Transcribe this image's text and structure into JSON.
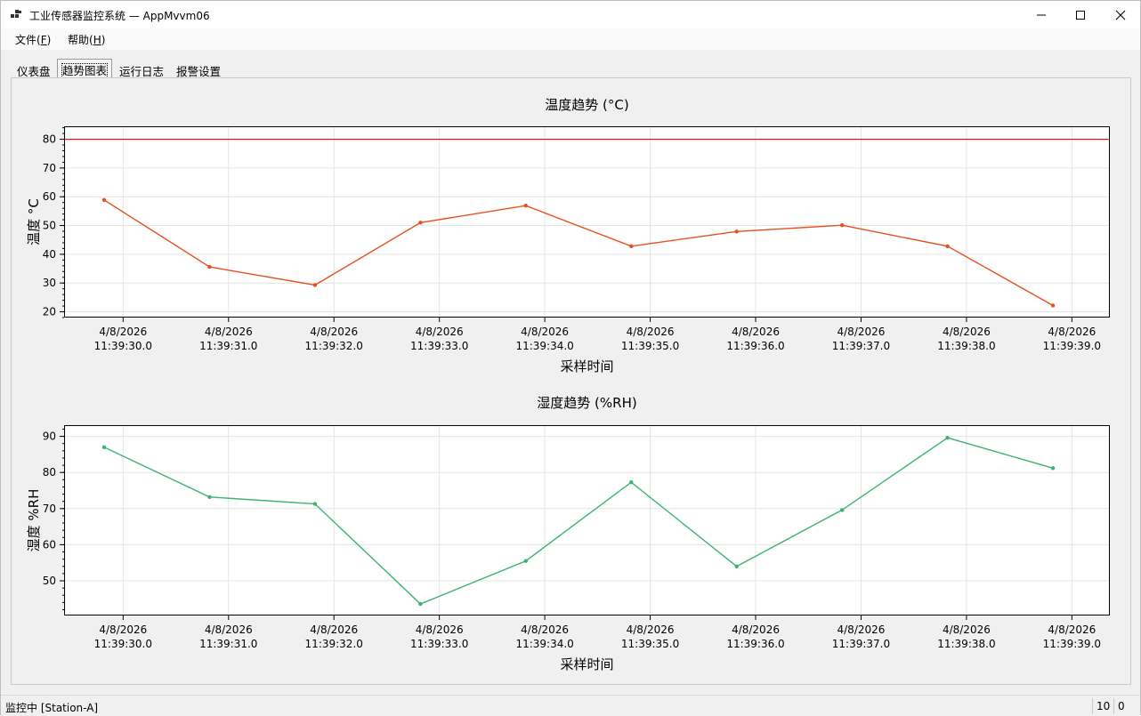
{
  "window": {
    "title": "工业传感器监控系统 — AppMvvm06"
  },
  "menu": {
    "file": "文件",
    "file_key": "F",
    "help": "帮助",
    "help_key": "H"
  },
  "tabs": [
    {
      "label": "仪表盘",
      "active": false
    },
    {
      "label": "趋势图表",
      "active": true
    },
    {
      "label": "运行日志",
      "active": false
    },
    {
      "label": "报警设置",
      "active": false
    }
  ],
  "status": {
    "text": "监控中 [Station-A]",
    "count": "10",
    "alarms": "0"
  },
  "chart_data": [
    {
      "type": "line",
      "title": "温度趋势 (°C)",
      "xlabel": "采样时间",
      "ylabel": "温度 °C",
      "x": [
        "4/8/2026 11:39:30.0",
        "4/8/2026 11:39:31.0",
        "4/8/2026 11:39:32.0",
        "4/8/2026 11:39:33.0",
        "4/8/2026 11:39:34.0",
        "4/8/2026 11:39:35.0",
        "4/8/2026 11:39:36.0",
        "4/8/2026 11:39:37.0",
        "4/8/2026 11:39:38.0",
        "4/8/2026 11:39:39.0"
      ],
      "tick_dates": [
        "4/8/2026",
        "4/8/2026",
        "4/8/2026",
        "4/8/2026",
        "4/8/2026",
        "4/8/2026",
        "4/8/2026",
        "4/8/2026",
        "4/8/2026",
        "4/8/2026"
      ],
      "tick_times": [
        "11:39:30.0",
        "11:39:31.0",
        "11:39:32.0",
        "11:39:33.0",
        "11:39:34.0",
        "11:39:35.0",
        "11:39:36.0",
        "11:39:37.0",
        "11:39:38.0",
        "11:39:39.0"
      ],
      "point_x_seconds": [
        29.82,
        30.82,
        31.82,
        32.82,
        33.82,
        34.82,
        35.82,
        36.82,
        37.82,
        38.82
      ],
      "series": [
        {
          "values": [
            58.9,
            35.6,
            29.3,
            51.0,
            56.9,
            42.8,
            47.9,
            50.1,
            42.8,
            22.2
          ],
          "color": "#e8501e"
        }
      ],
      "yticks": [
        20,
        30,
        40,
        50,
        60,
        70,
        80
      ],
      "ylim": [
        18,
        84.5
      ],
      "xlim": [
        29.44,
        39.36
      ],
      "threshold": {
        "value": 80,
        "color": "#ff0000"
      },
      "grid": true
    },
    {
      "type": "line",
      "title": "湿度趋势 (%RH)",
      "xlabel": "采样时间",
      "ylabel": "湿度 %RH",
      "x": [
        "4/8/2026 11:39:30.0",
        "4/8/2026 11:39:31.0",
        "4/8/2026 11:39:32.0",
        "4/8/2026 11:39:33.0",
        "4/8/2026 11:39:34.0",
        "4/8/2026 11:39:35.0",
        "4/8/2026 11:39:36.0",
        "4/8/2026 11:39:37.0",
        "4/8/2026 11:39:38.0",
        "4/8/2026 11:39:39.0"
      ],
      "tick_dates": [
        "4/8/2026",
        "4/8/2026",
        "4/8/2026",
        "4/8/2026",
        "4/8/2026",
        "4/8/2026",
        "4/8/2026",
        "4/8/2026",
        "4/8/2026",
        "4/8/2026"
      ],
      "tick_times": [
        "11:39:30.0",
        "11:39:31.0",
        "11:39:32.0",
        "11:39:33.0",
        "11:39:34.0",
        "11:39:35.0",
        "11:39:36.0",
        "11:39:37.0",
        "11:39:38.0",
        "11:39:39.0"
      ],
      "point_x_seconds": [
        29.82,
        30.82,
        31.82,
        32.82,
        33.82,
        34.82,
        35.82,
        36.82,
        37.82,
        38.82
      ],
      "series": [
        {
          "values": [
            87.0,
            73.2,
            71.3,
            43.6,
            55.5,
            77.3,
            54.0,
            69.6,
            89.6,
            81.2
          ],
          "color": "#3cb371"
        }
      ],
      "yticks": [
        50,
        60,
        70,
        80,
        90
      ],
      "ylim": [
        40.4,
        93.1
      ],
      "xlim": [
        29.44,
        39.36
      ],
      "grid": true
    }
  ]
}
